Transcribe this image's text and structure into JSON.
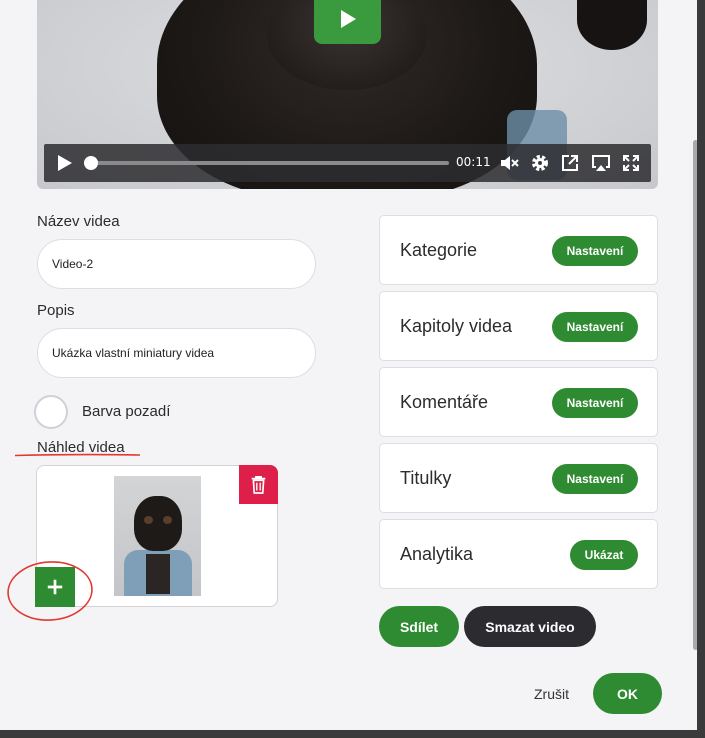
{
  "player": {
    "time": "00:11",
    "progress_fraction": 0.0
  },
  "form": {
    "title_label": "Název videa",
    "title_value": "Video-2",
    "description_label": "Popis",
    "description_value": "Ukázka vlastní miniatury videa",
    "bg_color_label": "Barva pozadí",
    "thumbnail_label": "Náhled videa"
  },
  "settings": [
    {
      "label": "Kategorie",
      "button": "Nastavení"
    },
    {
      "label": "Kapitoly videa",
      "button": "Nastavení"
    },
    {
      "label": "Komentáře",
      "button": "Nastavení"
    },
    {
      "label": "Titulky",
      "button": "Nastavení"
    },
    {
      "label": "Analytika",
      "button": "Ukázat"
    }
  ],
  "actions": {
    "share": "Sdílet",
    "delete_video": "Smazat video",
    "cancel": "Zrušit",
    "ok": "OK"
  },
  "colors": {
    "green": "#2f8b31",
    "red": "#dd1f49",
    "dark": "#2b2b30"
  }
}
